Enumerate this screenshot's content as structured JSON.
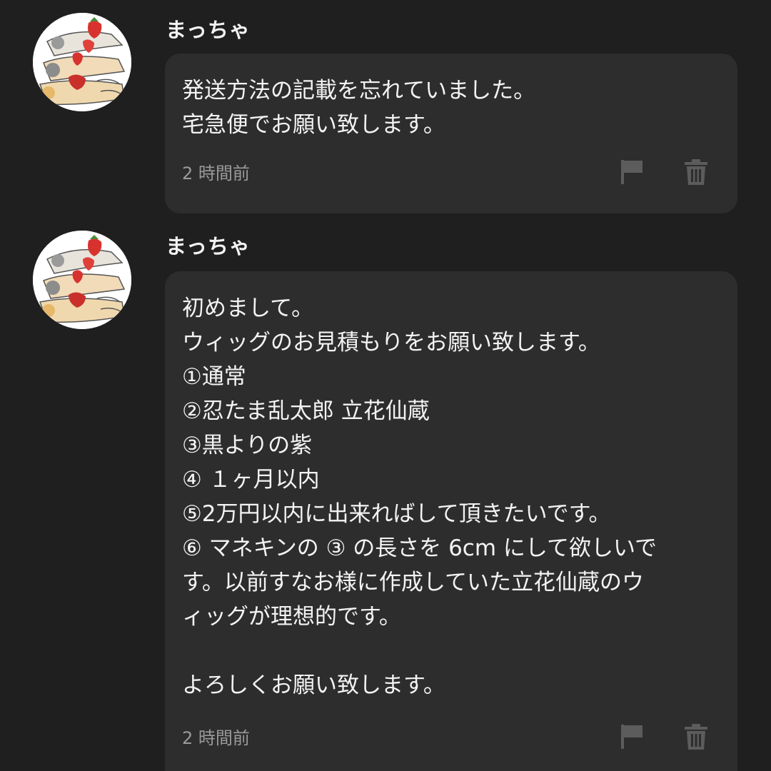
{
  "messages": [
    {
      "username": "まっちゃ",
      "avatar_icon": "strawberry-hamster-avatar",
      "text": "発送方法の記載を忘れていました。\n宅急便でお願い致します。",
      "timestamp": "2 時間前",
      "flag_icon": "flag-icon",
      "delete_icon": "trash-icon"
    },
    {
      "username": "まっちゃ",
      "avatar_icon": "strawberry-hamster-avatar",
      "text": "初めまして。\nウィッグのお見積もりをお願い致します。\n①通常\n②忍たま乱太郎 立花仙蔵\n③黒よりの紫\n④ １ヶ月以内\n⑤2万円以内に出来ればして頂きたいです。\n⑥ マネキンの ③ の長さを 6cm にして欲しいで\nす。以前すなお様に作成していた立花仙蔵のウ\nィッグが理想的です。\n\nよろしくお願い致します。",
      "timestamp": "2 時間前",
      "flag_icon": "flag-icon",
      "delete_icon": "trash-icon"
    }
  ],
  "colors": {
    "background": "#1f1f1f",
    "bubble": "#2d2d2e",
    "text": "#f3f3f3",
    "muted": "#9a9a9a",
    "icon": "#5c5c5c"
  }
}
